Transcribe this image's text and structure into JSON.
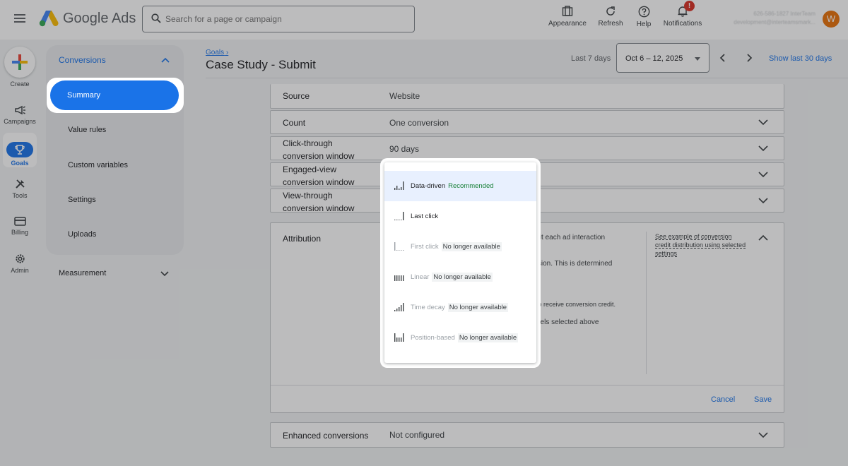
{
  "header": {
    "brand": "Google Ads",
    "search_placeholder": "Search for a page or campaign",
    "tools": [
      "Appearance",
      "Refresh",
      "Help",
      "Notifications"
    ],
    "notification_badge": "!",
    "account_line1": "626-586-1827 InterTeam",
    "account_line2": "development@interteamsmark...",
    "avatar_initial": "W"
  },
  "rail": {
    "create": "Create",
    "campaigns": "Campaigns",
    "goals": "Goals",
    "tools": "Tools",
    "billing": "Billing",
    "admin": "Admin"
  },
  "subnav": {
    "section": "Conversions",
    "items": [
      "Summary",
      "Value rules",
      "Custom variables",
      "Settings",
      "Uploads"
    ],
    "measurement": "Measurement"
  },
  "page": {
    "breadcrumb": "Goals",
    "breadcrumb_sep": "›",
    "title": "Case Study - Submit",
    "range_label": "Last 7 days",
    "date_range": "Oct 6 – 12, 2025",
    "show_last_30": "Show last 30 days"
  },
  "settings": {
    "rows": [
      {
        "label": "Source",
        "value": "Website"
      },
      {
        "label": "Count",
        "value": "One conversion"
      },
      {
        "label": "Click-through conversion window",
        "value": "90 days"
      },
      {
        "label": "Engaged-view conversion window",
        "value": ""
      },
      {
        "label": "View-through conversion window",
        "value": ""
      }
    ],
    "enhanced": {
      "label": "Enhanced conversions",
      "value": "Not configured"
    }
  },
  "attribution": {
    "title": "Attribution",
    "desc_fragments": [
      "h credit each ad interaction",
      "version. This is determined",
      "to receive conversion credit.",
      "nels selected above"
    ],
    "example_link": "See example of conversion credit distribution using selected settings",
    "cancel": "Cancel",
    "save": "Save"
  },
  "dropdown": {
    "recommended": "Recommended",
    "unavailable": "No longer available",
    "options": [
      {
        "name": "Data-driven",
        "selected": true,
        "enabled": true
      },
      {
        "name": "Last click",
        "selected": false,
        "enabled": true
      },
      {
        "name": "First click",
        "selected": false,
        "enabled": false
      },
      {
        "name": "Linear",
        "selected": false,
        "enabled": false
      },
      {
        "name": "Time decay",
        "selected": false,
        "enabled": false
      },
      {
        "name": "Position-based",
        "selected": false,
        "enabled": false
      }
    ]
  },
  "colors": {
    "primary": "#1a73e8",
    "recommended": "#188038",
    "badge": "#d93025",
    "avatar": "#e8710a"
  }
}
